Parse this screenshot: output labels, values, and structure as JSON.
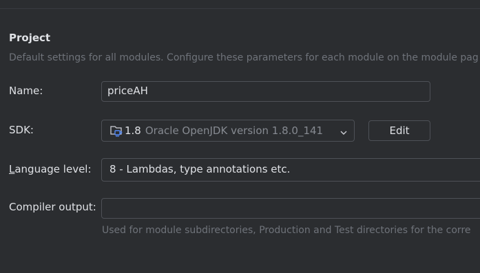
{
  "project": {
    "title": "Project",
    "description": "Default settings for all modules. Configure these parameters for each module on the module pag"
  },
  "name": {
    "label": "Name:",
    "value": "priceAH"
  },
  "sdk": {
    "label": "SDK:",
    "icon": "folder-java-icon",
    "version": "1.8",
    "description": "Oracle OpenJDK version 1.8.0_141",
    "edit_label": "Edit"
  },
  "language_level": {
    "label_mnemonic": "L",
    "label_rest": "anguage level:",
    "value": "8 - Lambdas, type annotations etc."
  },
  "compiler_output": {
    "label": "Compiler output:",
    "value": "",
    "hint": "Used for module subdirectories, Production and Test directories for the corre"
  },
  "colors": {
    "background": "#2b2d30",
    "text": "#dfe1e5",
    "muted_text": "#6f737a",
    "border": "#4e5157",
    "icon_accent": "#548af7"
  }
}
